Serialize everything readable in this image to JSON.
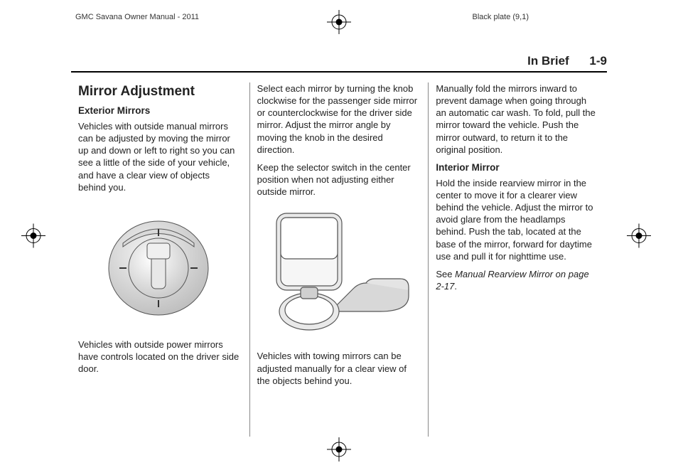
{
  "meta": {
    "doc_title": "GMC Savana Owner Manual - 2011",
    "plate": "Black plate (9,1)"
  },
  "header": {
    "section": "In Brief",
    "page": "1-9"
  },
  "col1": {
    "heading": "Mirror Adjustment",
    "sub1": "Exterior Mirrors",
    "p1": "Vehicles with outside manual mirrors can be adjusted by moving the mirror up and down or left to right so you can see a little of the side of your vehicle, and have a clear view of objects behind you.",
    "p2": "Vehicles with outside power mirrors have controls located on the driver side door."
  },
  "col2": {
    "p1": "Select each mirror by turning the knob clockwise for the passenger side mirror or counterclockwise for the driver side mirror. Adjust the mirror angle by moving the knob in the desired direction.",
    "p2": "Keep the selector switch in the center position when not adjusting either outside mirror.",
    "p3": "Vehicles with towing mirrors can be adjusted manually for a clear view of the objects behind you."
  },
  "col3": {
    "p1": "Manually fold the mirrors inward to prevent damage when going through an automatic car wash. To fold, pull the mirror toward the vehicle. Push the mirror outward, to return it to the original position.",
    "sub1": "Interior Mirror",
    "p2": "Hold the inside rearview mirror in the center to move it for a clearer view behind the vehicle. Adjust the mirror to avoid glare from the headlamps behind. Push the tab, located at the base of the mirror, forward for daytime use and pull it for nighttime use.",
    "see_prefix": "See ",
    "see_ref": "Manual Rearview Mirror on page 2-17",
    "see_suffix": "."
  },
  "icons": {
    "crop": "crop-mark-icon",
    "knob": "mirror-knob-figure",
    "towing": "towing-mirror-figure"
  }
}
